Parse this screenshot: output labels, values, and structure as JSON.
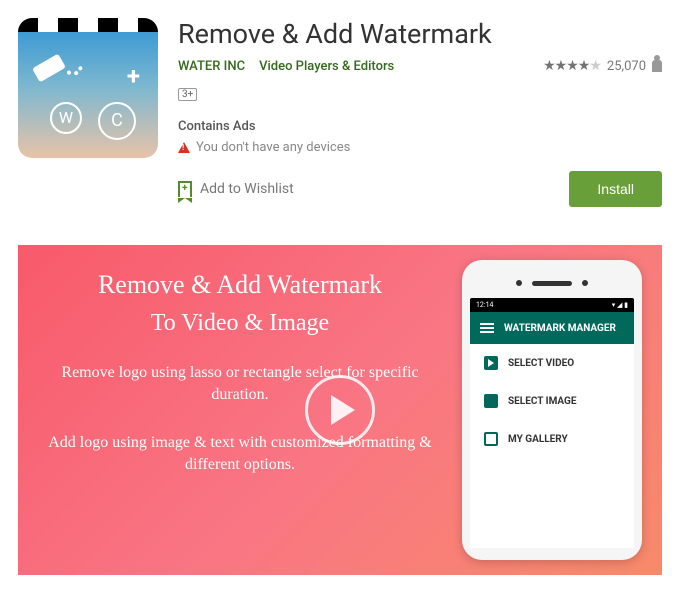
{
  "app": {
    "title": "Remove & Add Watermark",
    "developer": "WATER INC",
    "category": "Video Players & Editors",
    "rating_count": "25,070",
    "content_rating": "3+",
    "contains_ads": "Contains Ads",
    "device_warning": "You don't have any devices",
    "wishlist_label": "Add to Wishlist",
    "install_label": "Install",
    "icon_letters": {
      "left": "W",
      "right": "C",
      "plus": "+"
    }
  },
  "promo": {
    "line1": "Remove & Add Watermark",
    "line2": "To Video & Image",
    "desc1": "Remove logo using lasso or rectangle select for specific duration.",
    "desc2": "Add logo using image & text with customized formatting & different options."
  },
  "phone": {
    "time": "12:14",
    "app_title": "WATERMARK MANAGER",
    "items": [
      {
        "label": "SELECT VIDEO"
      },
      {
        "label": "SELECT IMAGE"
      },
      {
        "label": "MY GALLERY"
      }
    ]
  }
}
